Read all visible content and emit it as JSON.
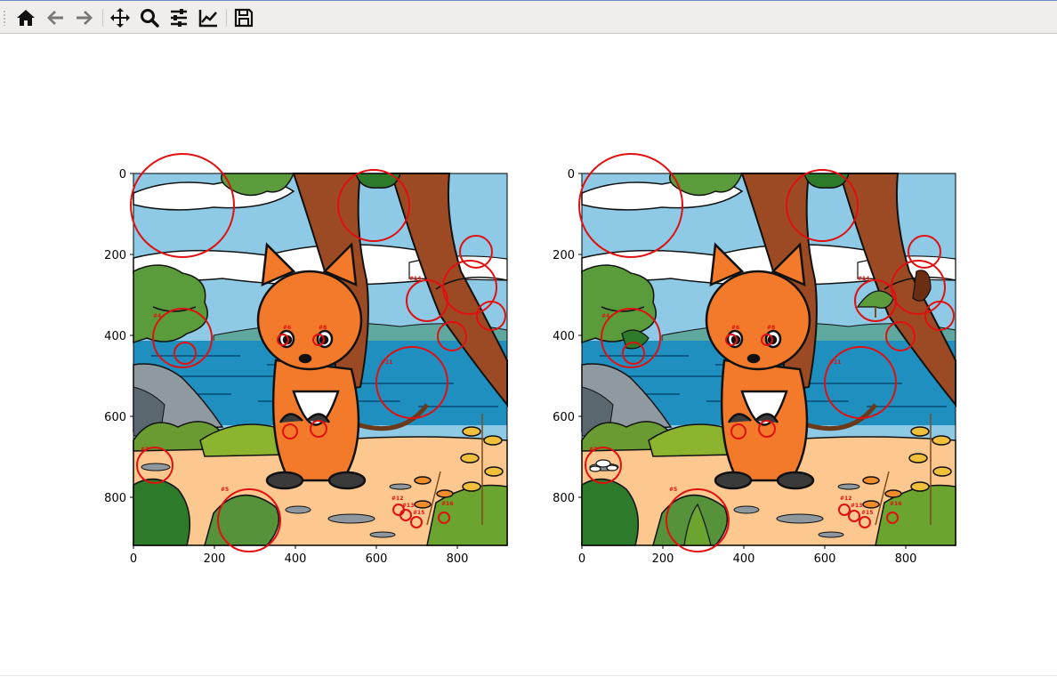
{
  "toolbar": {
    "buttons": [
      {
        "name": "home-button",
        "icon": "home-icon"
      },
      {
        "name": "back-button",
        "icon": "arrow-left-icon"
      },
      {
        "name": "forward-button",
        "icon": "arrow-right-icon"
      },
      {
        "name": "pan-button",
        "icon": "move-icon"
      },
      {
        "name": "zoom-button",
        "icon": "magnifier-icon"
      },
      {
        "name": "configure-subplots-button",
        "icon": "sliders-icon"
      },
      {
        "name": "edit-axes-button",
        "icon": "line-chart-icon"
      },
      {
        "name": "save-button",
        "icon": "floppy-icon"
      }
    ]
  },
  "plots": [
    {
      "name": "left-plot",
      "x_ticks": [
        "0",
        "200",
        "400",
        "600",
        "800"
      ],
      "y_ticks": [
        "0",
        "200",
        "400",
        "600",
        "800"
      ],
      "marker_labels": [
        "#14",
        "#4",
        "#6",
        "#8",
        "#11",
        "#7",
        "#5",
        "#12",
        "#13",
        "#15",
        "#16"
      ]
    },
    {
      "name": "right-plot",
      "x_ticks": [
        "0",
        "200",
        "400",
        "600",
        "800"
      ],
      "y_ticks": [
        "0",
        "200",
        "400",
        "600",
        "800"
      ],
      "marker_labels": [
        "#14",
        "#4",
        "#6",
        "#8",
        "#11",
        "#7",
        "#5",
        "#12",
        "#13",
        "#15",
        "#16"
      ]
    }
  ],
  "colors": {
    "circle": "#e01010",
    "sky": "#8ecae6",
    "sea": "#1e8fbf",
    "sand": "#fdc790",
    "fox": "#f27a2a",
    "trunk": "#9b4a24"
  }
}
